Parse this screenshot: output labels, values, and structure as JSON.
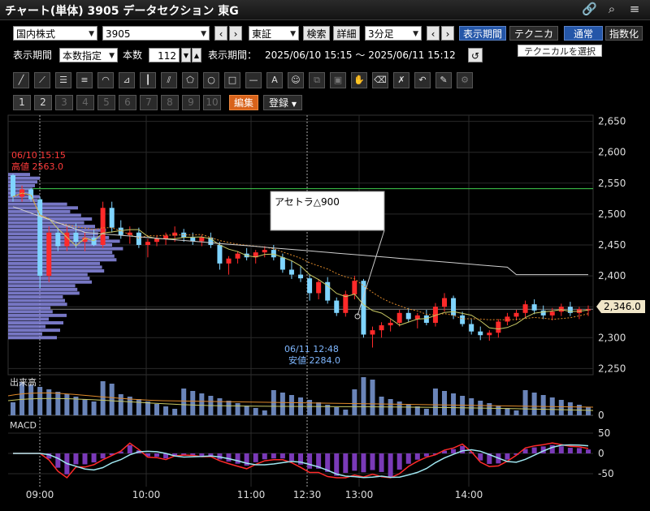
{
  "window": {
    "title": "チャート(単体) 3905 データセクション 東G"
  },
  "toolbar1": {
    "market": "国内株式",
    "code": "3905",
    "exchange": "東証",
    "search": "検索",
    "detail": "詳細",
    "interval": "3分足",
    "display_period": "表示期間",
    "technical": "テクニカル",
    "normal": "通常",
    "index": "指数化",
    "tooltip": "テクニカルを選択"
  },
  "toolbar2": {
    "period_label": "表示期間",
    "period_mode": "本数指定",
    "count_label": "本数",
    "count_value": "112",
    "range_label": "表示期間：",
    "range_value": "2025/06/10 15:15 ～ 2025/06/11 15:12"
  },
  "pager": {
    "pages": [
      "1",
      "2",
      "3",
      "4",
      "5",
      "6",
      "7",
      "8",
      "9",
      "10"
    ],
    "edit": "編集",
    "register": "登録"
  },
  "chart_data": {
    "type": "candlestick",
    "price_ticks": [
      2650,
      2600,
      2550,
      2500,
      2450,
      2400,
      2350,
      2300,
      2250
    ],
    "ylim": [
      2240,
      2660
    ],
    "time_labels": [
      "09:00",
      "10:00",
      "11:00",
      "12:30",
      "13:00",
      "14:00"
    ],
    "current_price": "2,346.0",
    "high_annotation": [
      "06/10 15:15",
      "高値 2563.0"
    ],
    "low_annotation": [
      "06/11 12:48",
      "安値 2284.0"
    ],
    "callout": "アセトラ△900",
    "green_line": 2541,
    "volume_label": "出来高",
    "macd_label": "MACD",
    "macd_ticks": [
      "50",
      "0",
      "-50"
    ],
    "candles": [
      [
        2563,
        2565,
        2520,
        2528
      ],
      [
        2528,
        2546,
        2520,
        2540
      ],
      [
        2540,
        2542,
        2520,
        2524
      ],
      [
        2524,
        2528,
        2380,
        2400
      ],
      [
        2400,
        2480,
        2390,
        2470
      ],
      [
        2470,
        2478,
        2440,
        2448
      ],
      [
        2448,
        2480,
        2440,
        2470
      ],
      [
        2470,
        2485,
        2445,
        2455
      ],
      [
        2455,
        2470,
        2440,
        2462
      ],
      [
        2462,
        2475,
        2448,
        2450
      ],
      [
        2450,
        2520,
        2445,
        2510
      ],
      [
        2510,
        2520,
        2470,
        2478
      ],
      [
        2478,
        2490,
        2460,
        2466
      ],
      [
        2466,
        2480,
        2452,
        2470
      ],
      [
        2470,
        2478,
        2445,
        2450
      ],
      [
        2450,
        2460,
        2430,
        2455
      ],
      [
        2455,
        2466,
        2448,
        2460
      ],
      [
        2460,
        2470,
        2450,
        2465
      ],
      [
        2465,
        2480,
        2455,
        2470
      ],
      [
        2470,
        2476,
        2455,
        2462
      ],
      [
        2462,
        2470,
        2450,
        2456
      ],
      [
        2456,
        2466,
        2448,
        2462
      ],
      [
        2462,
        2470,
        2445,
        2450
      ],
      [
        2450,
        2455,
        2410,
        2420
      ],
      [
        2420,
        2432,
        2402,
        2428
      ],
      [
        2428,
        2440,
        2420,
        2436
      ],
      [
        2436,
        2445,
        2425,
        2430
      ],
      [
        2430,
        2442,
        2420,
        2438
      ],
      [
        2438,
        2448,
        2430,
        2442
      ],
      [
        2442,
        2450,
        2425,
        2430
      ],
      [
        2430,
        2436,
        2405,
        2410
      ],
      [
        2410,
        2425,
        2395,
        2402
      ],
      [
        2402,
        2415,
        2390,
        2396
      ],
      [
        2396,
        2402,
        2360,
        2372
      ],
      [
        2372,
        2395,
        2362,
        2390
      ],
      [
        2390,
        2398,
        2355,
        2360
      ],
      [
        2360,
        2365,
        2335,
        2340
      ],
      [
        2340,
        2376,
        2334,
        2370
      ],
      [
        2370,
        2400,
        2362,
        2392
      ],
      [
        2392,
        2395,
        2300,
        2305
      ],
      [
        2305,
        2318,
        2284,
        2312
      ],
      [
        2312,
        2325,
        2300,
        2320
      ],
      [
        2320,
        2330,
        2310,
        2324
      ],
      [
        2324,
        2345,
        2318,
        2340
      ],
      [
        2340,
        2348,
        2325,
        2330
      ],
      [
        2330,
        2340,
        2315,
        2336
      ],
      [
        2336,
        2345,
        2320,
        2324
      ],
      [
        2324,
        2356,
        2318,
        2350
      ],
      [
        2350,
        2372,
        2342,
        2364
      ],
      [
        2364,
        2368,
        2330,
        2336
      ],
      [
        2336,
        2342,
        2318,
        2322
      ],
      [
        2322,
        2330,
        2305,
        2310
      ],
      [
        2310,
        2318,
        2296,
        2304
      ],
      [
        2304,
        2312,
        2295,
        2308
      ],
      [
        2308,
        2330,
        2300,
        2326
      ],
      [
        2326,
        2340,
        2320,
        2334
      ],
      [
        2334,
        2345,
        2328,
        2340
      ],
      [
        2340,
        2360,
        2332,
        2354
      ],
      [
        2354,
        2362,
        2338,
        2344
      ],
      [
        2344,
        2352,
        2330,
        2336
      ],
      [
        2336,
        2348,
        2328,
        2342
      ],
      [
        2342,
        2355,
        2335,
        2350
      ],
      [
        2350,
        2358,
        2335,
        2340
      ],
      [
        2340,
        2350,
        2330,
        2346
      ],
      [
        2346,
        2352,
        2335,
        2346
      ]
    ]
  }
}
